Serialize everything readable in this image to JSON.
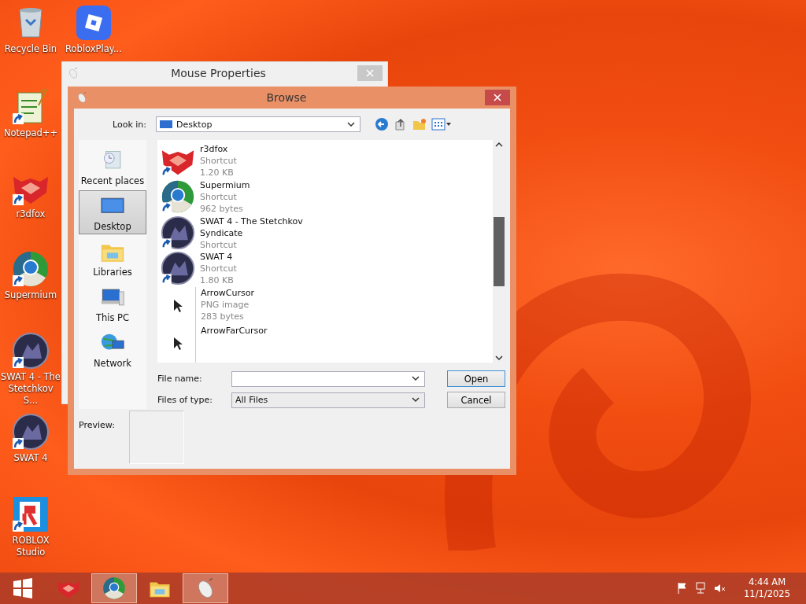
{
  "desktop_icons": [
    {
      "label": "Recycle Bin",
      "kind": "recycle",
      "shortcut": false
    },
    {
      "label": "RobloxPlay...",
      "kind": "roblox",
      "shortcut": false
    },
    {
      "label": "Notepad++",
      "kind": "notepad",
      "shortcut": true
    },
    {
      "label": "r3dfox",
      "kind": "fox",
      "shortcut": true
    },
    {
      "label": "Supermium",
      "kind": "browser",
      "shortcut": true
    },
    {
      "label": "SWAT 4 - The Stetchkov S...",
      "kind": "game",
      "shortcut": true
    },
    {
      "label": "SWAT 4",
      "kind": "game",
      "shortcut": true
    },
    {
      "label": "ROBLOX Studio",
      "kind": "studio",
      "shortcut": true
    }
  ],
  "background_window": {
    "title": "Mouse Properties"
  },
  "dialog": {
    "title": "Browse",
    "look_in": {
      "label": "Look in:",
      "value": "Desktop"
    },
    "places": [
      {
        "label": "Recent places",
        "kind": "recent",
        "selected": false
      },
      {
        "label": "Desktop",
        "kind": "desktop",
        "selected": true
      },
      {
        "label": "Libraries",
        "kind": "libraries",
        "selected": false
      },
      {
        "label": "This PC",
        "kind": "pc",
        "selected": false
      },
      {
        "label": "Network",
        "kind": "network",
        "selected": false
      }
    ],
    "files": [
      {
        "name": "r3dfox",
        "details": [
          "Shortcut",
          "1.20 KB"
        ],
        "kind": "fox",
        "shortcut": true
      },
      {
        "name": "Supermium",
        "details": [
          "Shortcut",
          "962 bytes"
        ],
        "kind": "browser",
        "shortcut": true
      },
      {
        "name": "SWAT 4 - The Stetchkov Syndicate",
        "details": [
          "Shortcut"
        ],
        "kind": "game",
        "shortcut": true
      },
      {
        "name": "SWAT 4",
        "details": [
          "Shortcut",
          "1.80 KB"
        ],
        "kind": "game",
        "shortcut": true
      },
      {
        "name": "ArrowCursor",
        "details": [
          "PNG image",
          "283 bytes"
        ],
        "kind": "cursor",
        "shortcut": false
      },
      {
        "name": "ArrowFarCursor",
        "kind": "cursor",
        "shortcut": false
      }
    ],
    "file_name": {
      "label": "File name:"
    },
    "files_of_type": {
      "label": "Files of type:",
      "value": "All Files"
    },
    "buttons": [
      {
        "label": "Open",
        "default": true
      },
      {
        "label": "Cancel",
        "default": false
      }
    ],
    "preview_label": "Preview:"
  },
  "taskbar": {
    "apps": [
      {
        "kind": "fox",
        "active": false
      },
      {
        "kind": "browser",
        "active": true
      },
      {
        "kind": "explorer",
        "active": false
      },
      {
        "kind": "mouse",
        "active": true
      }
    ],
    "time": "4:44 AM",
    "date": "11/1/2025"
  }
}
